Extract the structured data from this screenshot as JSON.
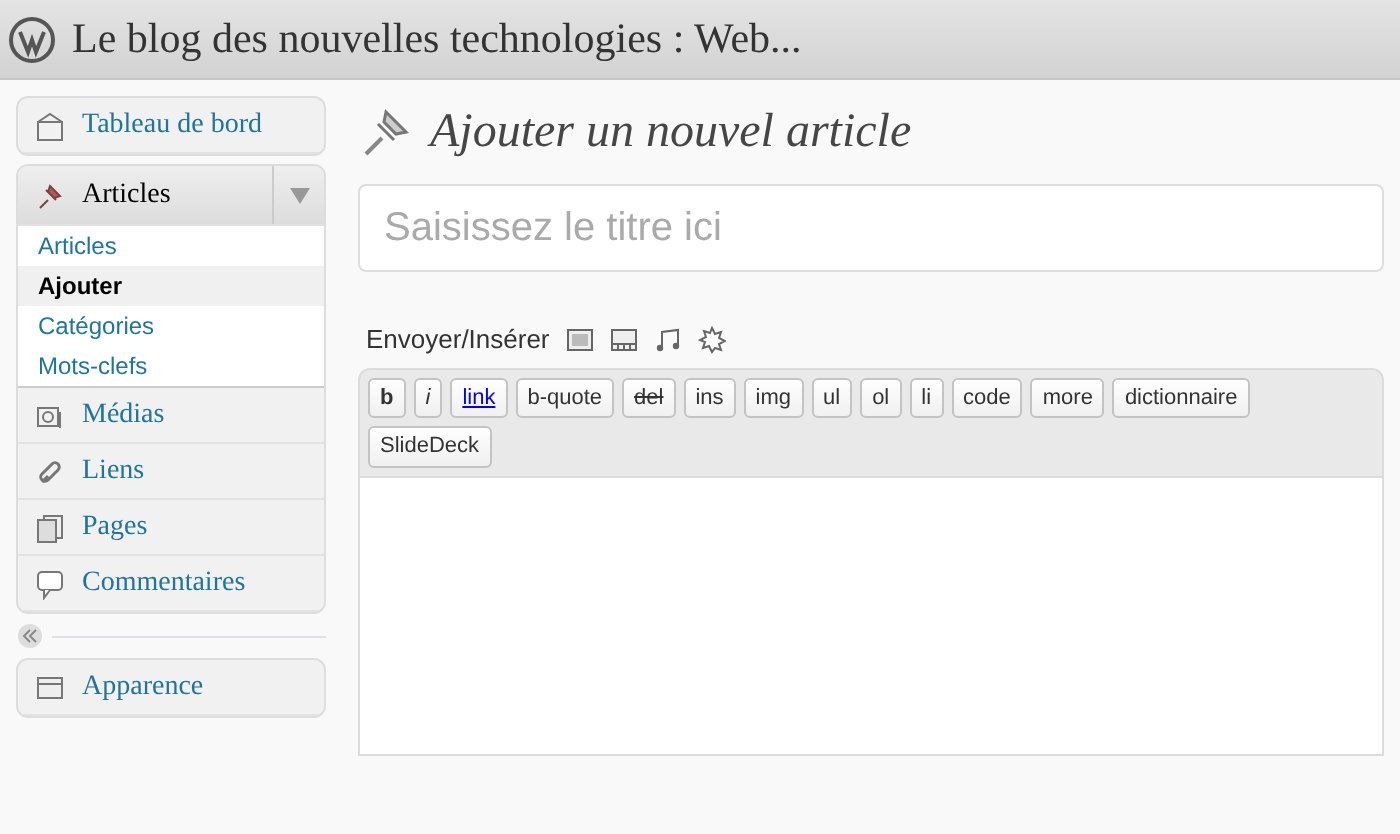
{
  "header": {
    "title": "Le blog des nouvelles technologies : Web..."
  },
  "sidebar": {
    "groups": [
      {
        "items": [
          {
            "label": "Tableau de bord",
            "expanded": false
          }
        ]
      },
      {
        "items": [
          {
            "label": "Articles",
            "expanded": true,
            "children": [
              {
                "label": "Articles",
                "selected": false
              },
              {
                "label": "Ajouter",
                "selected": true
              },
              {
                "label": "Catégories",
                "selected": false
              },
              {
                "label": "Mots-clefs",
                "selected": false
              }
            ]
          },
          {
            "label": "Médias",
            "expanded": false
          },
          {
            "label": "Liens",
            "expanded": false
          },
          {
            "label": "Pages",
            "expanded": false
          },
          {
            "label": "Commentaires",
            "expanded": false
          }
        ]
      },
      {
        "items": [
          {
            "label": "Apparence",
            "expanded": false
          }
        ]
      }
    ]
  },
  "page_title": "Ajouter un nouvel article",
  "title_field": {
    "placeholder": "Saisissez le titre ici"
  },
  "media_bar": {
    "label": "Envoyer/Insérer"
  },
  "quicktags": {
    "rows": [
      [
        {
          "label": "b",
          "kind": "bold"
        },
        {
          "label": "i",
          "kind": "italic"
        },
        {
          "label": "link",
          "kind": "link"
        },
        {
          "label": "b-quote",
          "kind": "plain"
        },
        {
          "label": "del",
          "kind": "strike"
        },
        {
          "label": "ins",
          "kind": "plain"
        },
        {
          "label": "img",
          "kind": "plain"
        },
        {
          "label": "ul",
          "kind": "plain"
        },
        {
          "label": "ol",
          "kind": "plain"
        },
        {
          "label": "li",
          "kind": "plain"
        },
        {
          "label": "code",
          "kind": "plain"
        },
        {
          "label": "more",
          "kind": "plain"
        },
        {
          "label": "dictionnaire",
          "kind": "plain"
        }
      ],
      [
        {
          "label": "SlideDeck",
          "kind": "plain"
        }
      ]
    ]
  }
}
